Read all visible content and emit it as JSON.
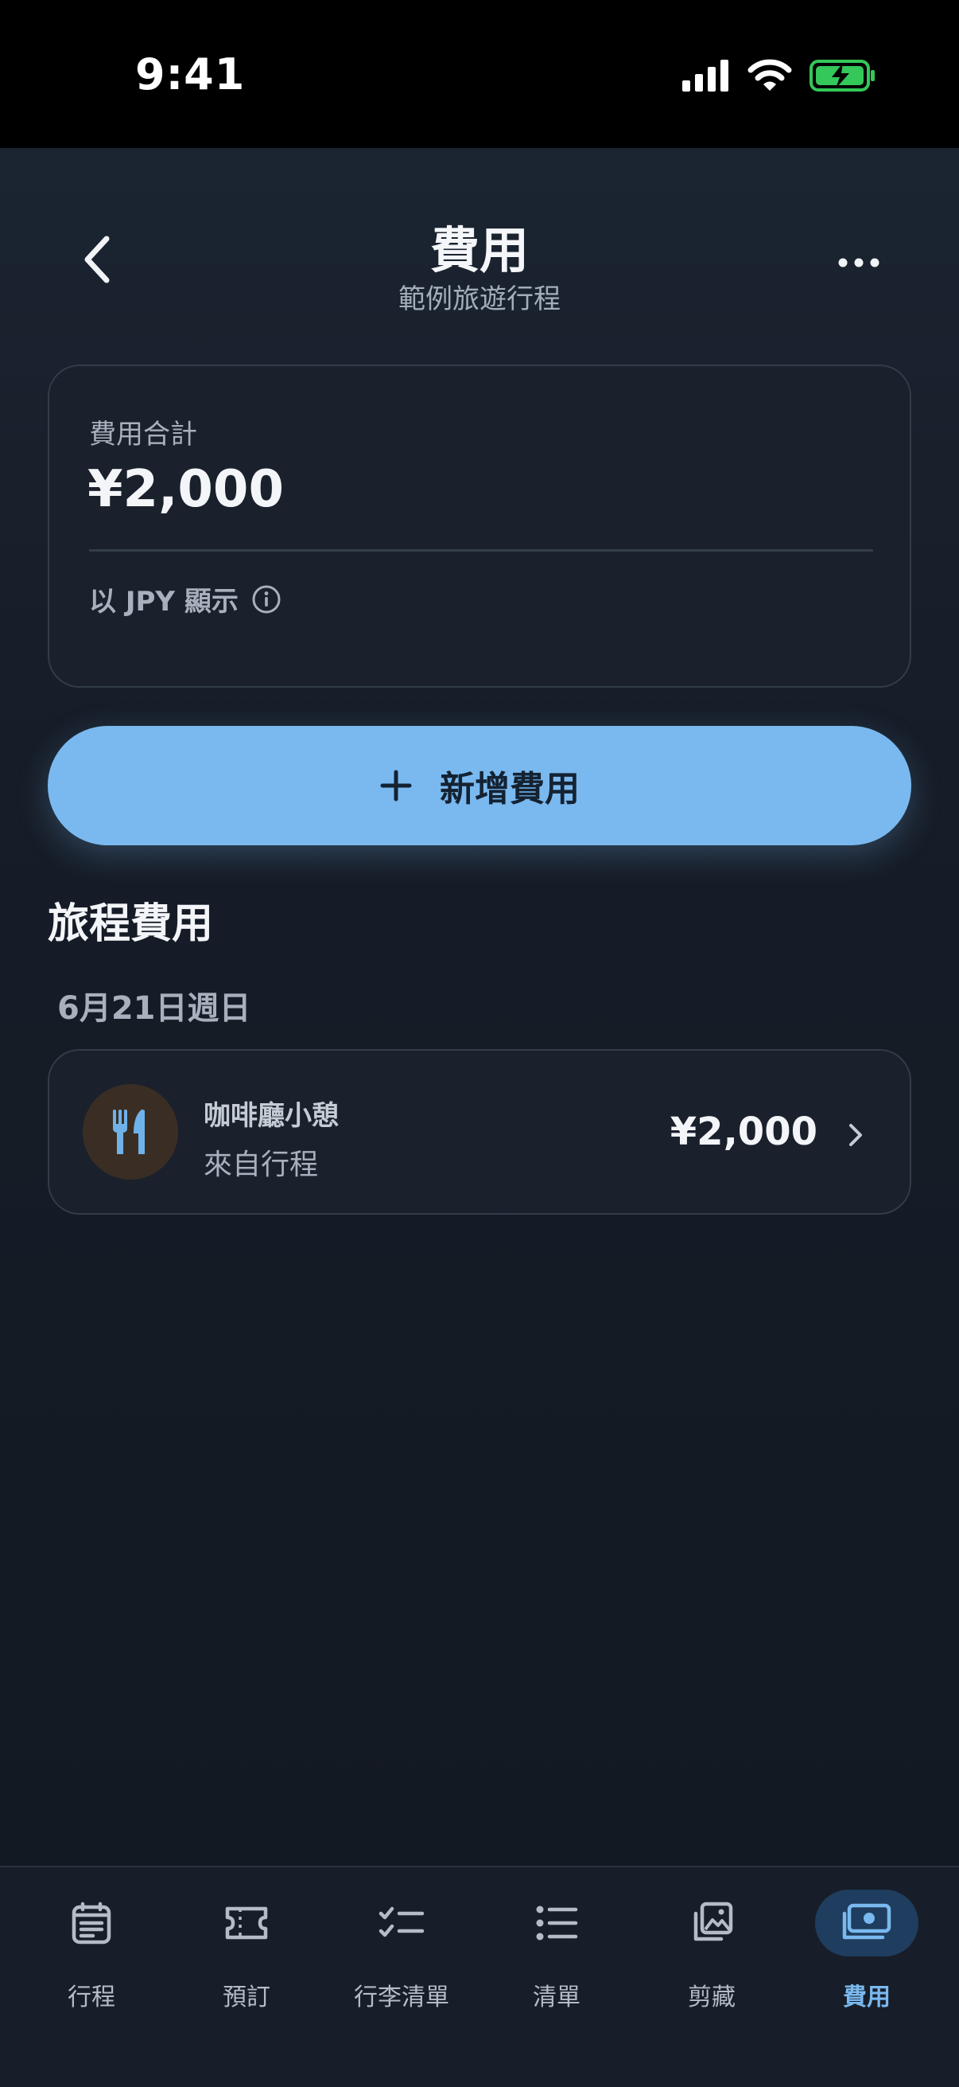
{
  "status_bar": {
    "time": "9:41"
  },
  "header": {
    "title": "費用",
    "subtitle": "範例旅遊行程"
  },
  "summary": {
    "label": "費用合計",
    "total": "¥2,000",
    "currency_note": "以 JPY 顯示"
  },
  "add_button": {
    "label": "新增費用"
  },
  "section": {
    "title": "旅程費用"
  },
  "groups": [
    {
      "date": "6月21日週日",
      "items": [
        {
          "name": "咖啡廳小憩",
          "source": "來自行程",
          "amount": "¥2,000",
          "icon": "fork-knife-icon"
        }
      ]
    }
  ],
  "tabs": [
    {
      "label": "行程",
      "icon": "itinerary-icon",
      "active": false
    },
    {
      "label": "預訂",
      "icon": "ticket-icon",
      "active": false
    },
    {
      "label": "行李清單",
      "icon": "checklist-icon",
      "active": false
    },
    {
      "label": "清單",
      "icon": "list-icon",
      "active": false
    },
    {
      "label": "剪藏",
      "icon": "photo-stack-icon",
      "active": false
    },
    {
      "label": "費用",
      "icon": "money-icon",
      "active": true
    }
  ],
  "colors": {
    "accent": "#7ab9ef",
    "background": "#151b25",
    "card": "#1a212c",
    "battery": "#34c759",
    "food_icon": "#6fb2ea"
  }
}
